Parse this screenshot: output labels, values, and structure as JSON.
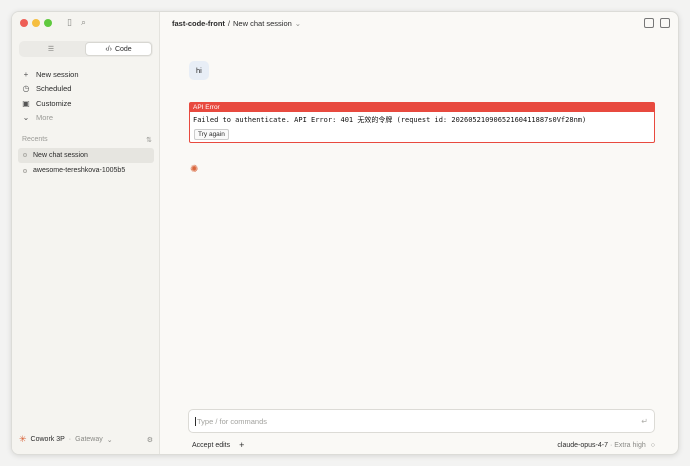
{
  "sidebar": {
    "mode_tabs": [
      {
        "label": "",
        "icon": "chat-list-icon"
      },
      {
        "label": "Code",
        "icon": "code-icon"
      }
    ],
    "nav": [
      {
        "label": "New session",
        "icon": "plus-icon"
      },
      {
        "label": "Scheduled",
        "icon": "clock-icon"
      },
      {
        "label": "Customize",
        "icon": "briefcase-icon"
      },
      {
        "label": "More",
        "icon": "chevron-down-icon"
      }
    ],
    "recents_label": "Recents",
    "recents": [
      {
        "label": "New chat session",
        "active": true
      },
      {
        "label": "awesome-tereshkova-1005b5",
        "active": false
      }
    ],
    "footer": {
      "name": "Cowork 3P",
      "sep": " · ",
      "gateway": "Gateway"
    }
  },
  "header": {
    "project": "fast-code-front",
    "sep": "/",
    "session": "New chat session"
  },
  "chat": {
    "user_message": "hi",
    "error": {
      "title": "API Error",
      "message": "Failed to authenticate. API Error: 401 无效的令牌 (request id: 20260521090652160411887s0Vf28nm)",
      "retry_label": "Try again"
    }
  },
  "composer": {
    "placeholder": "Type / for commands",
    "accept_edits_label": "Accept edits",
    "model": "claude-opus-4-7",
    "effort_sep": " · ",
    "effort": "Extra high"
  },
  "colors": {
    "error_red": "#e84a3f",
    "accent_orange": "#d9653b"
  }
}
